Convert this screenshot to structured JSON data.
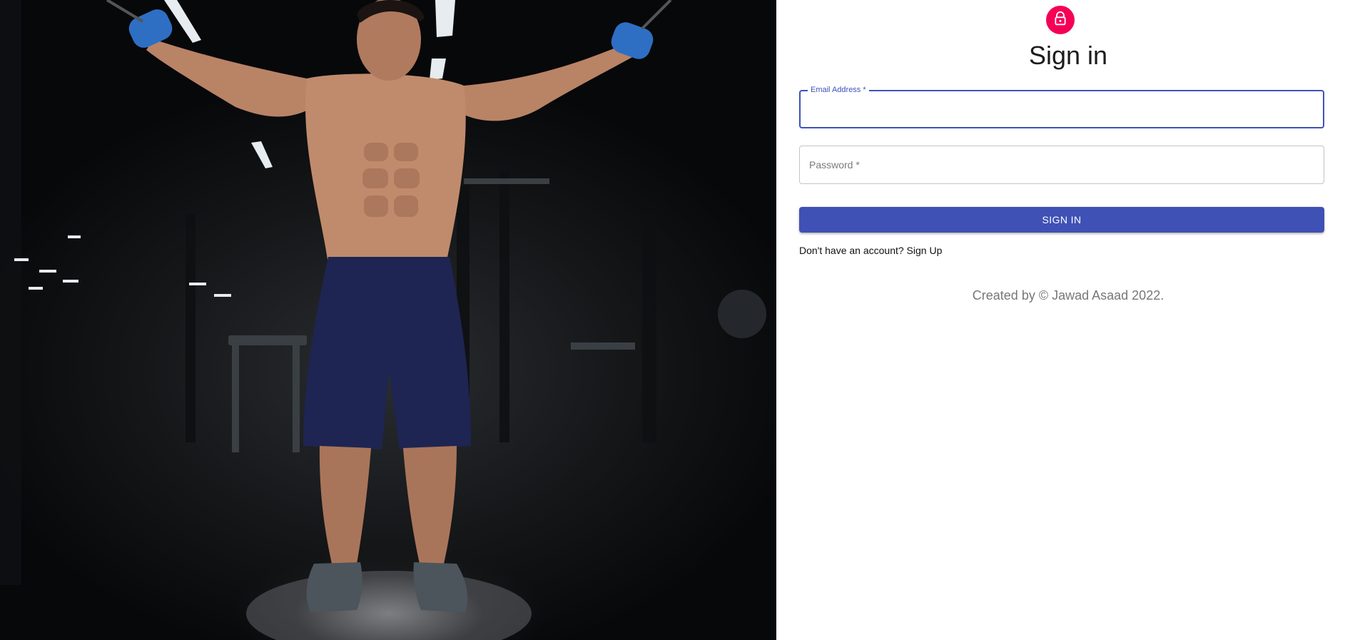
{
  "hero": {
    "image": "gym-athlete-photo"
  },
  "signin": {
    "icon": "lock-icon",
    "title": "Sign in",
    "email": {
      "label": "Email Address *",
      "value": ""
    },
    "password": {
      "label": "Password *",
      "value": ""
    },
    "submit_label": "SIGN IN",
    "signup_link": "Don't have an account? Sign Up"
  },
  "footer": {
    "text": "Created by © Jawad Asaad 2022."
  },
  "colors": {
    "accent": "#3f51b5",
    "avatar": "#f50057"
  }
}
